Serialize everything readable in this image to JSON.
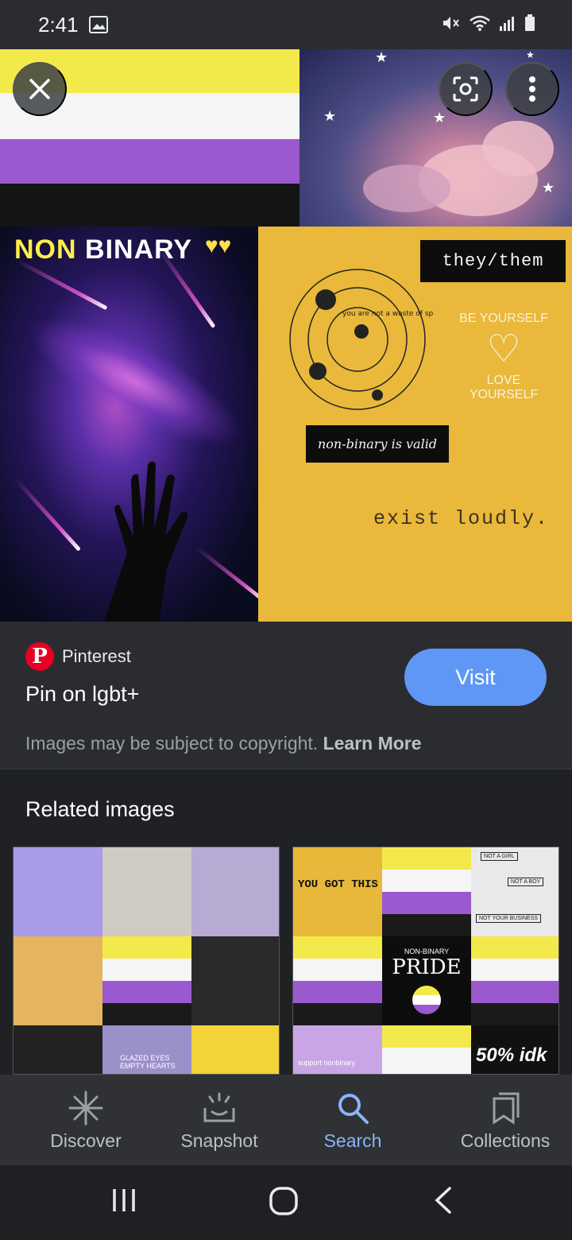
{
  "status_bar": {
    "time": "2:41"
  },
  "hero": {
    "title_part1": "NON",
    "title_part2": "BINARY",
    "tag_pronouns": "they/them",
    "tag_valid": "non-binary is valid",
    "quote": "exist loudly.",
    "be_yourself": "BE YOURSELF",
    "love_yourself": "LOVE YOURSELF",
    "solar_text": "you are not a waste of space",
    "flag_colors": [
      "#f4e94a",
      "#ffffff",
      "#9b59d0",
      "#1a1a1a"
    ]
  },
  "result": {
    "source": "Pinterest",
    "title": "Pin on lgbt+",
    "visit_label": "Visit",
    "copyright_text": "Images may be subject to copyright.",
    "learn_more": "Learn More"
  },
  "related": {
    "title": "Related images",
    "right_thumb": {
      "you_got_this": "YOU GOT THIS",
      "not_a_girl": "NOT A GIRL",
      "not_a_boy": "NOT A BOY",
      "not_your_business": "NOT YOUR BUSINESS",
      "pride_top": "NON-BINARY",
      "pride": "PRIDE",
      "percent": "50% idk",
      "support": "support nonbinary"
    },
    "left_thumb": {
      "glazed": "GLAZED EYES EMPTY HEARTS"
    }
  },
  "bottom_nav": {
    "items": [
      {
        "label": "Discover",
        "icon": "asterisk-icon",
        "active": false
      },
      {
        "label": "Snapshot",
        "icon": "snapshot-icon",
        "active": false
      },
      {
        "label": "Search",
        "icon": "search-icon",
        "active": true
      },
      {
        "label": "Collections",
        "icon": "bookmarks-icon",
        "active": false
      }
    ]
  },
  "colors": {
    "accent": "#8ab4f8",
    "visit_button": "#5e97f6",
    "pinterest_red": "#e60023",
    "yellow_panel": "#eab83a"
  }
}
